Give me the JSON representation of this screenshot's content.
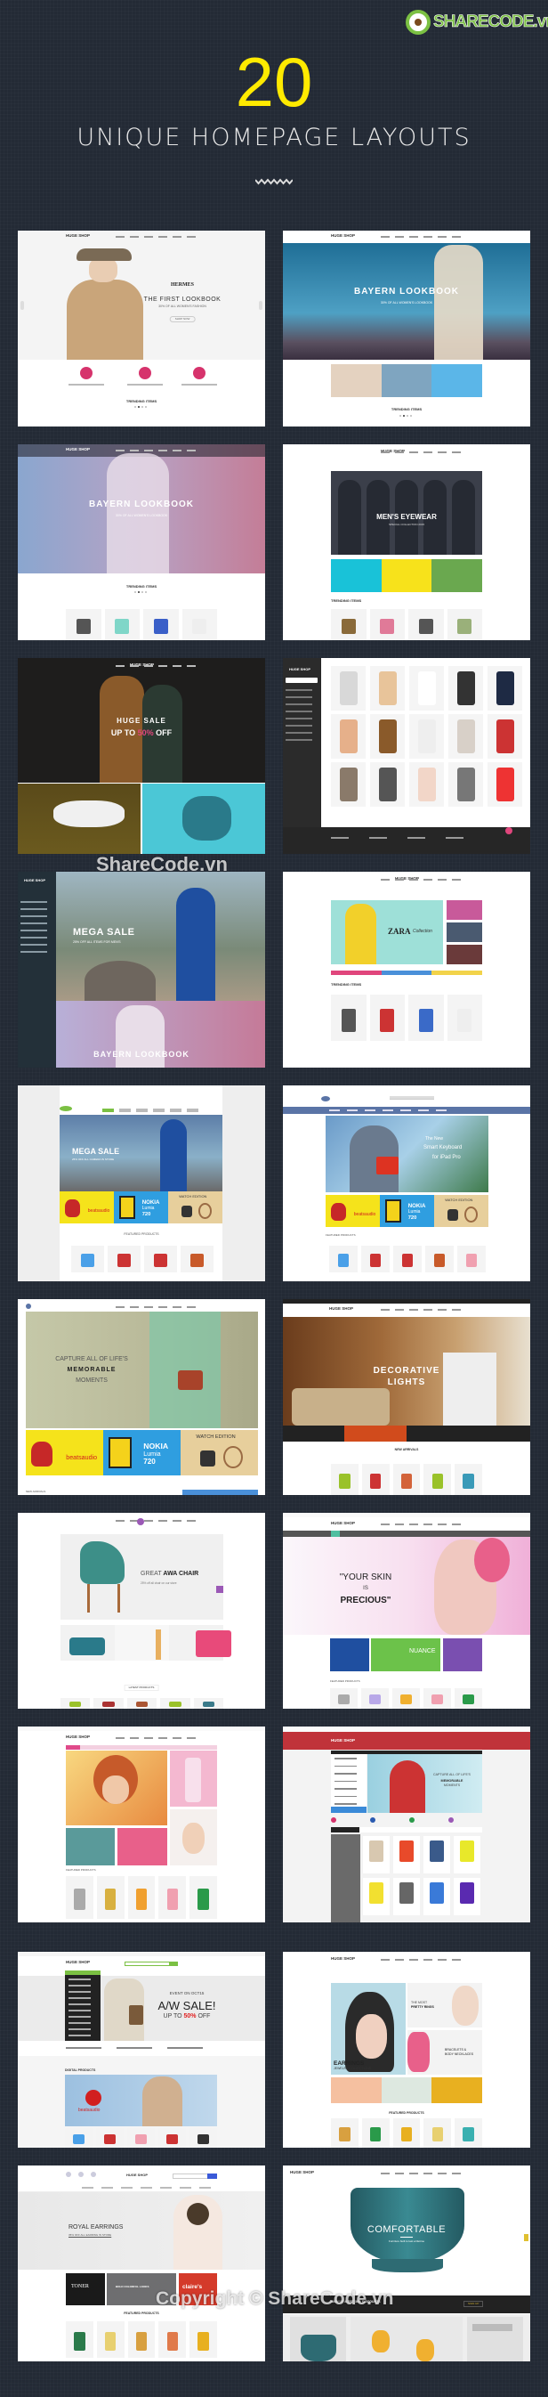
{
  "header": {
    "logo": "SHARECODE.vn",
    "count": "20",
    "subtitle": "UNIQUE HOMEPAGE LAYOUTS"
  },
  "watermarks": {
    "middle": "ShareCode.vn",
    "bottom": "Copyright © ShareCode.vn"
  },
  "colors": {
    "background": "#232a35",
    "count": "#ffea00",
    "accent_pink": "#d6336c",
    "logo_green": "#7bc043"
  },
  "thumbs": [
    {
      "logo": "HUGE SHOP",
      "brand": "HERMES",
      "title": "THE FIRST LOOKBOOK",
      "subtitle": "30% OF ALL WOMEN'S FASHION",
      "button": "SHOP NOW",
      "section": "TRENDING ITEMS"
    },
    {
      "logo": "HUGE SHOP",
      "title": "BAYERN LOOKBOOK",
      "subtitle": "30% OF ALL WOMEN'S LOOKBOOK",
      "section": "TRENDING ITEMS"
    },
    {
      "logo": "HUGE SHOP",
      "title": "BAYERN LOOKBOOK",
      "subtitle": "30% OF ALL WOMEN'S LOOKBOOK",
      "section": "TRENDING ITEMS"
    },
    {
      "logo": "HUGE SHOP",
      "title": "MEN'S EYEWEAR",
      "subtitle": "SPECIAL COLLECTION 2015",
      "section": "TRENDING ITEMS"
    },
    {
      "logo": "HUGE SHOP",
      "title": "HUGE SALE",
      "line2_a": "UP TO ",
      "line2_b": "50%",
      "line2_c": " OFF"
    },
    {
      "logo": "HUGE SHOP"
    },
    {
      "logo": "HUGE SHOP",
      "title": "MEGA SALE",
      "subtitle": "25% OFF ALL ITEMS FOR MEN'S",
      "title2": "BAYERN LOOKBOOK"
    },
    {
      "logo": "HUGE SHOP",
      "title": "ZARA",
      "title_script": "Collection",
      "section": "TRENDING ITEMS"
    },
    {
      "title": "MEGA SALE",
      "subtitle": "25% OFF ALL CAMERA IN STORE",
      "beats": "beatsaudio",
      "nokia": "NOKIA",
      "nokia_model": "Lumia",
      "nokia_num": "720",
      "watch": "WATCH EDITION",
      "section": "FEATURED PRODUCTS"
    },
    {
      "line1": "The New",
      "line2": "Smart Keyboard",
      "line3": "for iPad Pro",
      "beats": "beatsaudio",
      "nokia": "NOKIA",
      "nokia_model": "Lumia",
      "nokia_num": "720",
      "watch": "WATCH EDITION",
      "section": "FEATURED PRODUCTS"
    },
    {
      "line1": "CAPTURE ALL OF LIFE'S",
      "line2": "MEMORABLE",
      "line3": "MOMENTS",
      "beats": "beatsaudio",
      "nokia": "NOKIA",
      "nokia_model": "Lumia",
      "nokia_num": "720",
      "watch": "WATCH EDITION",
      "section": "NEW ARRIVALS"
    },
    {
      "logo": "HUGE SHOP",
      "line1": "DECORATIVE",
      "line2": "LIGHTS",
      "section": "NEW ARRIVALS"
    },
    {
      "title_a": "GREAT ",
      "title_b": "AWA CHAIR",
      "subtitle": "25% off all chair on our store",
      "section": "LATEST PRODUCTS"
    },
    {
      "logo": "HUGE SHOP",
      "line1": "\"YOUR SKIN",
      "line2": "IS",
      "line3": "PRECIOUS\"",
      "tile": "NUANCE",
      "section": "FEATURED PRODUCTS"
    },
    {
      "logo": "HUGE SHOP",
      "section": "FEATURED PRODUCTS"
    },
    {
      "logo": "HUGE SHOP",
      "line1": "CAPTURE ALL OF LIFE'S",
      "line2": "MEMORABLE",
      "line3": "MOMENTS"
    },
    {
      "logo": "HUGE SHOP",
      "event": "EVENT ON OCT15",
      "title": "A/W SALE!",
      "sub_a": "UP TO ",
      "sub_b": "50%",
      "sub_c": " OFF",
      "section": "DIGITAL PRODUCTS",
      "beats": "beatsaudio"
    },
    {
      "logo": "HUGE SHOP",
      "title": "EARRINGS",
      "subtitle": "JEWELRY COLLECTIONS",
      "tile1_a": "THE MOST",
      "tile1_b": "PRETTY RINGS",
      "tile2_a": "BRACELETS &",
      "tile2_b": "BODY NECKLACES",
      "section": "FEATURED PRODUCTS"
    },
    {
      "logo": "HUGE SHOP",
      "title": "ROYAL EARRINGS",
      "subtitle": "35% OFF ALL EARRING IN STORE",
      "tile1": "TONER",
      "tile2": "BOLD COLORFUL LOOKS",
      "tile3": "claire's",
      "section": "FEATURED PRODUCTS"
    },
    {
      "logo": "HUGE SHOP",
      "title": "COMFORTABLE",
      "subtitle": "Furniture built to last a lifetime",
      "signup": "SIGN UP & GET 30% DISCOUNTS",
      "button": "SIGN UP"
    }
  ]
}
